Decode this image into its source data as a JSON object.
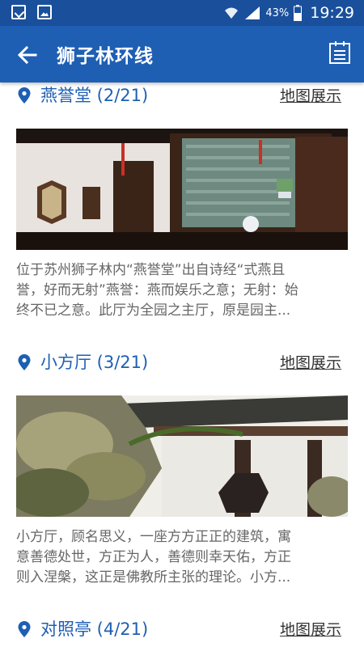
{
  "status_bar": {
    "battery": "43%",
    "time": "19:29"
  },
  "app_bar": {
    "title": "狮子林环线"
  },
  "sites": [
    {
      "title": "燕誉堂 (2/21)",
      "map_link": "地图展示",
      "description": [
        "位于苏州狮子林内“燕誉堂”出自诗经“式燕且",
        "誉，好而无射”燕誉：燕而娱乐之意；无射：始",
        "终不已之意。此厅为全园之主厅，原是园主..."
      ]
    },
    {
      "title": "小方厅 (3/21)",
      "map_link": "地图展示",
      "description": [
        "小方厅，顾名思义，一座方方正正的建筑，寓",
        "意善德处世，方正为人，善德则幸天佑，方正",
        "则入涅槃，这正是佛教所主张的理论。小方..."
      ]
    },
    {
      "title": "对照亭 (4/21)",
      "map_link": "地图展示"
    }
  ]
}
